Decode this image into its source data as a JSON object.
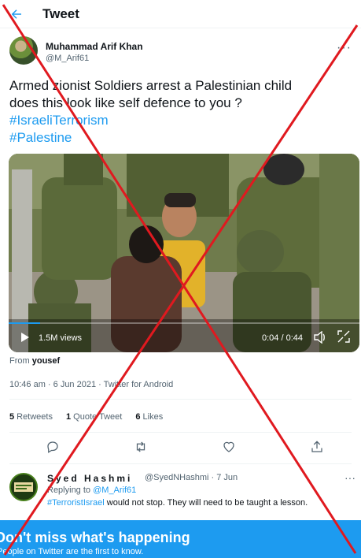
{
  "header": {
    "back_icon": "arrow-left-icon",
    "title": "Tweet"
  },
  "author": {
    "name": "Muhammad Arif Khan",
    "handle": "@M_Arif61"
  },
  "tweet": {
    "line1": "Armed zionist Soldiers arrest a Palestinian child",
    "line2": "does this look like self defence to you ?",
    "hashtag1": "#IsraeliTerrorism",
    "hashtag2": "#Palestine"
  },
  "video": {
    "views": "1.5M views",
    "time": "0:04 / 0:44",
    "progress": 0.09
  },
  "from": {
    "prefix": "From",
    "user": "yousef"
  },
  "meta": "10:46 am · 6 Jun 2021 · Twitter for Android",
  "stats": {
    "retweets_count": "5",
    "retweets_label": "Retweets",
    "quotes_count": "1",
    "quotes_label": "Quote Tweet",
    "likes_count": "6",
    "likes_label": "Likes"
  },
  "reply": {
    "name": "Syed Hashmi",
    "handle_time": "@SyedNHashmi · 7 Jun",
    "replying_prefix": "Replying to",
    "replying_to": "@M_Arif61",
    "hashtag": "#TerroristIsrael",
    "text": " would not stop.  They will need to be taught a lesson."
  },
  "banner": {
    "title": "Don't miss what's happening",
    "subtitle": "People on Twitter are the first to know."
  },
  "colors": {
    "accent": "#1d9bf0",
    "cross": "#e0191f"
  }
}
